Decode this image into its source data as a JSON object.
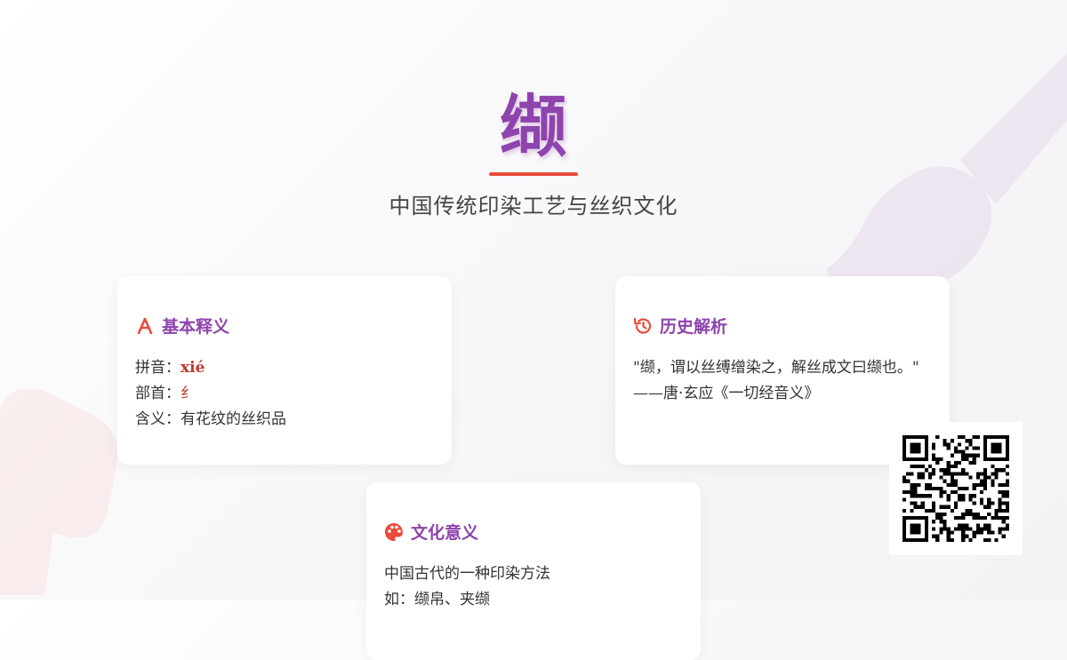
{
  "hero": {
    "character": "缬",
    "subtitle": "中国传统印染工艺与丝织文化"
  },
  "cards": {
    "basic": {
      "title": "基本释义",
      "icon": "font-icon",
      "pinyin_label": "拼音：",
      "pinyin_value": "xié",
      "radical_label": "部首：",
      "radical_value": "纟",
      "meaning_label": "含义：",
      "meaning_value": "有花纹的丝织品"
    },
    "history": {
      "title": "历史解析",
      "icon": "history-icon",
      "quote": "\"缬，谓以丝缚缯染之，解丝成文曰缬也。\"",
      "source": "——唐·玄应《一切经音义》"
    },
    "culture": {
      "title": "文化意义",
      "icon": "palette-icon",
      "line1": "中国古代的一种印染方法",
      "line2": "如：缬帛、夹缬"
    }
  },
  "colors": {
    "primary": "#8e44ad",
    "accent": "#e74c3c"
  }
}
